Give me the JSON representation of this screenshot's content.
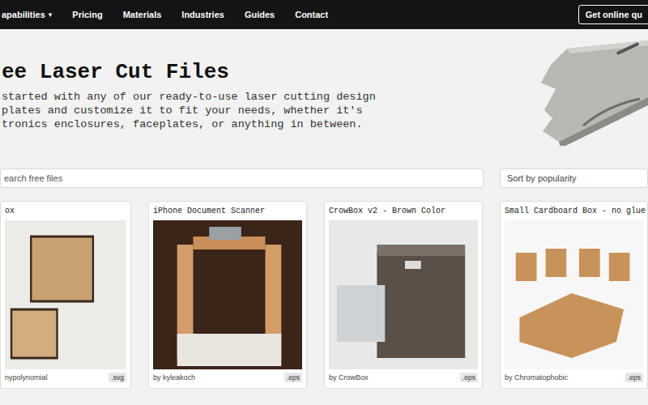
{
  "nav": {
    "items": [
      {
        "label": "apabilities",
        "icon": "▾"
      },
      {
        "label": "Pricing"
      },
      {
        "label": "Materials"
      },
      {
        "label": "Industries"
      },
      {
        "label": "Guides"
      },
      {
        "label": "Contact"
      }
    ],
    "cta": "Get online qu"
  },
  "hero": {
    "title": "ee Laser Cut Files",
    "lines": [
      "started with any of our ready-to-use laser cutting design",
      "plates and customize it to fit your needs, whether it's",
      "tronics enclosures, faceplates, or anything in between."
    ]
  },
  "search": {
    "placeholder": "earch free files"
  },
  "sort": {
    "value": "Sort by popularity"
  },
  "cards": [
    {
      "title": "ox",
      "author": "nypolynomial",
      "format": ".svg"
    },
    {
      "title": "iPhone Document Scanner",
      "author": "by kyleakoch",
      "format": ".eps"
    },
    {
      "title": "CrowBox v2 - Brown Color",
      "author": "by CrowBox",
      "format": ".eps"
    },
    {
      "title": "Small Cardboard Box - no glue",
      "author": "by Chromatophobic",
      "format": ".eps"
    }
  ]
}
